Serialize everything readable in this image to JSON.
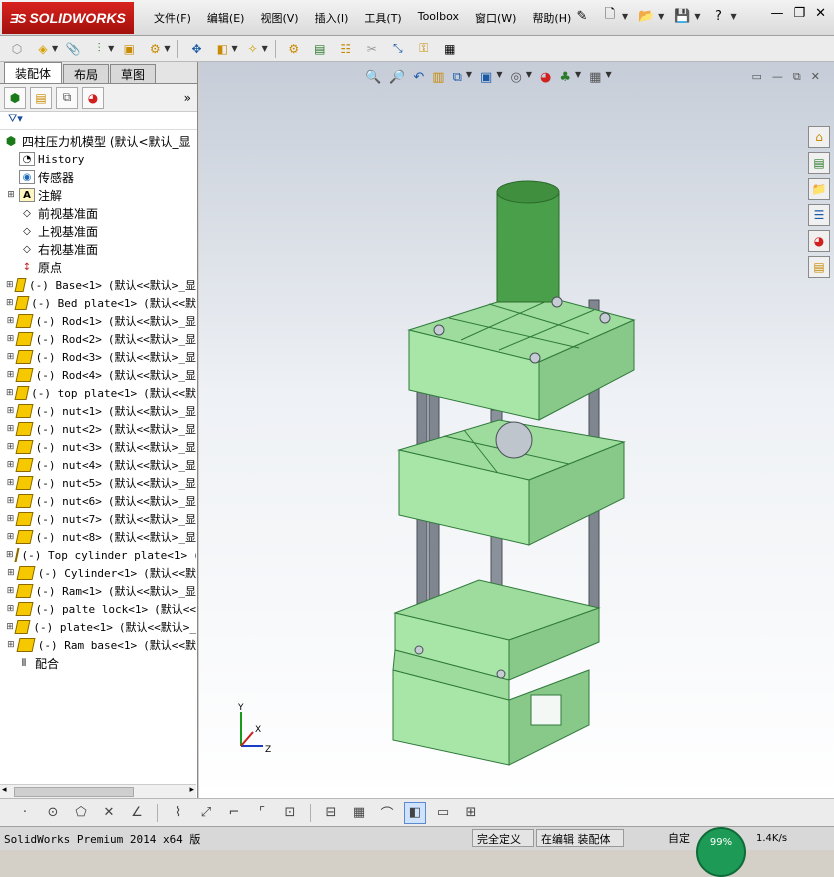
{
  "app": {
    "logo_text": "SOLIDWORKS",
    "logo_prefix": "ƎS"
  },
  "menu": [
    "文件(F)",
    "编辑(E)",
    "视图(V)",
    "插入(I)",
    "工具(T)",
    "Toolbox",
    "窗口(W)",
    "帮助(H)"
  ],
  "panel_tabs": [
    "装配体",
    "布局",
    "草图"
  ],
  "tree": {
    "root": "四柱压力机模型  (默认<默认_显",
    "fixed": [
      {
        "label": "History",
        "mono": true
      },
      {
        "label": "传感器",
        "mono": false
      },
      {
        "label": "注解",
        "mono": false
      },
      {
        "label": "前视基准面",
        "mono": false
      },
      {
        "label": "上视基准面",
        "mono": false
      },
      {
        "label": "右视基准面",
        "mono": false
      },
      {
        "label": "原点",
        "mono": false
      }
    ],
    "parts": [
      {
        "name": "(-) Base<1>",
        "config": "(默认<<默认>_显"
      },
      {
        "name": "(-) Bed plate<1>",
        "config": "(默认<<默"
      },
      {
        "name": "(-) Rod<1>",
        "config": "(默认<<默认>_显"
      },
      {
        "name": "(-) Rod<2>",
        "config": "(默认<<默认>_显"
      },
      {
        "name": "(-) Rod<3>",
        "config": "(默认<<默认>_显"
      },
      {
        "name": "(-) Rod<4>",
        "config": "(默认<<默认>_显"
      },
      {
        "name": "(-) top plate<1>",
        "config": "(默认<<默"
      },
      {
        "name": "(-) nut<1>",
        "config": "(默认<<默认>_显"
      },
      {
        "name": "(-) nut<2>",
        "config": "(默认<<默认>_显"
      },
      {
        "name": "(-) nut<3>",
        "config": "(默认<<默认>_显"
      },
      {
        "name": "(-) nut<4>",
        "config": "(默认<<默认>_显"
      },
      {
        "name": "(-) nut<5>",
        "config": "(默认<<默认>_显"
      },
      {
        "name": "(-) nut<6>",
        "config": "(默认<<默认>_显"
      },
      {
        "name": "(-) nut<7>",
        "config": "(默认<<默认>_显"
      },
      {
        "name": "(-) nut<8>",
        "config": "(默认<<默认>_显"
      },
      {
        "name": "(-) Top cylinder plate<1>",
        "config": "(默"
      },
      {
        "name": "(-) Cylinder<1>",
        "config": "(默认<<默"
      },
      {
        "name": "(-) Ram<1>",
        "config": "(默认<<默认>_显"
      },
      {
        "name": "(-) palte lock<1>",
        "config": "(默认<<"
      },
      {
        "name": "(-) plate<1>",
        "config": "(默认<<默认>_"
      },
      {
        "name": "(-) Ram base<1>",
        "config": "(默认<<默"
      }
    ],
    "mates": "配合"
  },
  "triad": {
    "x": "X",
    "y": "Y",
    "z": "Z"
  },
  "status": {
    "main": "SolidWorks Premium 2014 x64 版",
    "state": "完全定义",
    "mode": "在编辑 装配体",
    "custom": "自定",
    "net_percent": "99%",
    "speed": "1.4K/s"
  },
  "colors": {
    "part_green": "#a8e6a8",
    "part_edge": "#2f7a3a",
    "rod": "#7f8690",
    "part_icon": "#f5c800"
  }
}
